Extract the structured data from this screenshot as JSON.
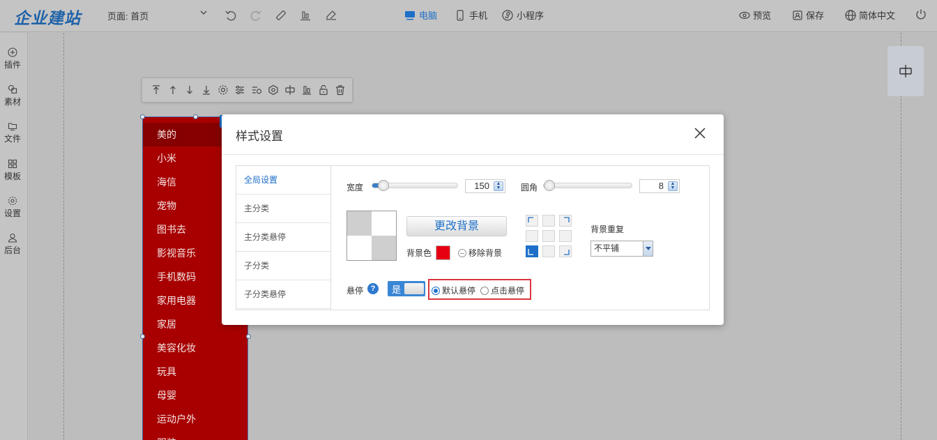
{
  "topbar": {
    "logo": "企业建站",
    "page_label": "页面:",
    "page_value": "首页",
    "devices": [
      {
        "label": "电脑",
        "icon": "monitor-icon",
        "active": true
      },
      {
        "label": "手机",
        "icon": "phone-icon",
        "active": false
      },
      {
        "label": "小程序",
        "icon": "mini-program-icon",
        "active": false
      }
    ],
    "actions": [
      {
        "label": "预览",
        "icon": "eye-icon"
      },
      {
        "label": "保存",
        "icon": "save-icon"
      },
      {
        "label": "简体中文",
        "icon": "globe-icon"
      }
    ]
  },
  "sidebar": {
    "items": [
      {
        "label": "插件",
        "icon": "plus-circle-icon"
      },
      {
        "label": "素材",
        "icon": "shapes-icon"
      },
      {
        "label": "文件",
        "icon": "folder-icon"
      },
      {
        "label": "模板",
        "icon": "grid-icon"
      },
      {
        "label": "设置",
        "icon": "gear-icon"
      },
      {
        "label": "后台",
        "icon": "user-icon"
      }
    ]
  },
  "categories": [
    "美的",
    "小米",
    "海信",
    "宠物",
    "图书去",
    "影视音乐",
    "手机数码",
    "家用电器",
    "家居",
    "美容化妆",
    "玩具",
    "母婴",
    "运动户外",
    "服装"
  ],
  "modal": {
    "title": "样式设置",
    "tabs": [
      "全局设置",
      "主分类",
      "主分类悬停",
      "子分类",
      "子分类悬停"
    ],
    "active_tab": 0,
    "width_label": "宽度",
    "width_value": "150",
    "width_fraction": 0.08,
    "radius_label": "圆角",
    "radius_value": "8",
    "radius_fraction": 0.0,
    "change_bg_label": "更改背景",
    "bg_color_label": "背景色",
    "bg_color": "#e60012",
    "remove_bg_label": "移除背景",
    "bg_repeat_label": "背景重复",
    "bg_repeat_value": "不平铺",
    "bg_position_selected": "bottom-left",
    "hover_label": "悬停",
    "toggle_label": "是",
    "radio_options": [
      {
        "label": "默认悬停",
        "checked": true
      },
      {
        "label": "点击悬停",
        "checked": false
      }
    ]
  }
}
